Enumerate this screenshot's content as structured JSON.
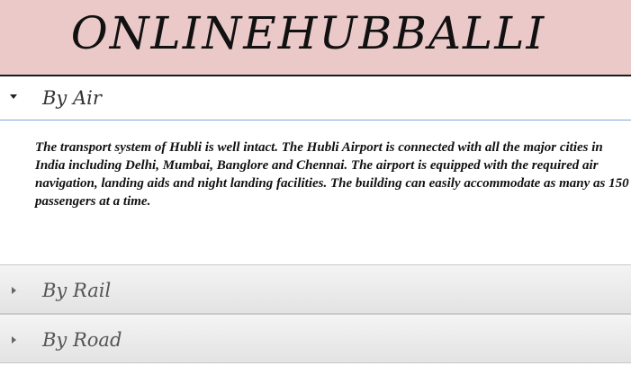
{
  "header": {
    "site_title": "ONLINEHUBBALLI"
  },
  "accordion": {
    "sections": [
      {
        "label": "By Air",
        "expanded": true,
        "icon": "caret-down-icon",
        "content": "The transport system of Hubli is well intact. The Hubli Airport is connected with all the major cities in India including Delhi, Mumbai, Banglore and Chennai. The airport is equipped with the required air navigation, landing aids and night landing facilities.  The building can easily accommodate as many as 150 passengers at a time."
      },
      {
        "label": "By Rail",
        "expanded": false,
        "icon": "caret-right-icon"
      },
      {
        "label": "By Road",
        "expanded": false,
        "icon": "caret-right-icon"
      }
    ]
  },
  "colors": {
    "header_background": "#ecc9c9",
    "active_underline": "#7fa5de"
  }
}
